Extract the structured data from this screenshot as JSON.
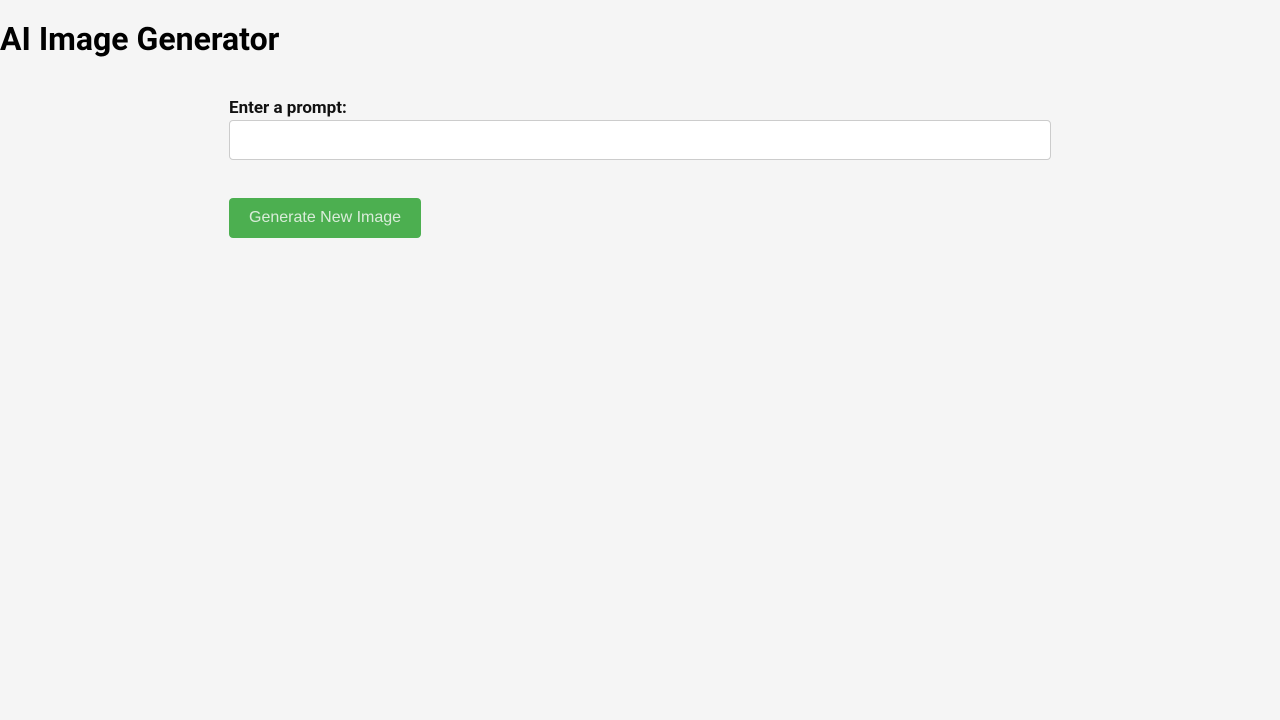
{
  "page": {
    "title": "AI Image Generator"
  },
  "form": {
    "prompt_label": "Enter a prompt:",
    "prompt_value": "",
    "generate_button_label": "Generate New Image"
  },
  "colors": {
    "background": "#f5f5f5",
    "button_bg": "#4CAF50",
    "button_text": "#d9ecd9",
    "input_border": "#ccc"
  }
}
